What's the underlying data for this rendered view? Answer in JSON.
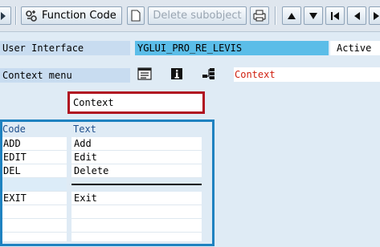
{
  "toolbar": {
    "function_code_label": "Function Code",
    "delete_subobject_label": "Delete subobject"
  },
  "header": {
    "user_interface_label": "User Interface",
    "user_interface_value": "YGLUI_PRO_RE_LEVIS",
    "status": "Active"
  },
  "context_row": {
    "label": "Context menu",
    "menu_title": "Context"
  },
  "menu_title_box": "Context",
  "table": {
    "col_code": "Code",
    "col_text": "Text",
    "rows": [
      {
        "code": "ADD",
        "text": "Add"
      },
      {
        "code": "EDIT",
        "text": "Edit"
      },
      {
        "code": "DEL",
        "text": "Delete"
      },
      {
        "code": "",
        "text": ""
      },
      {
        "code": "EXIT",
        "text": "Exit"
      },
      {
        "code": "",
        "text": ""
      },
      {
        "code": "",
        "text": ""
      },
      {
        "code": "",
        "text": ""
      }
    ]
  },
  "colors": {
    "red_highlight": "#b01020",
    "blue_highlight": "#1f82c0",
    "field_blue": "#5bbde8",
    "context_text": "#d02010"
  }
}
